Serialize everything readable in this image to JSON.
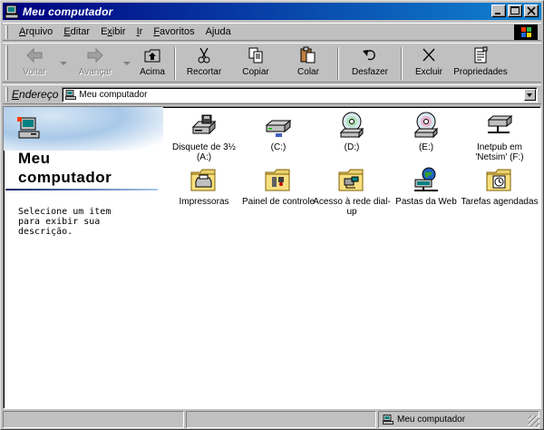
{
  "window": {
    "title": "Meu computador"
  },
  "menu": [
    {
      "label": "Arquivo",
      "accel": "A",
      "rest": "rquivo"
    },
    {
      "label": "Editar",
      "accel": "E",
      "rest": "ditar"
    },
    {
      "label": "Exibir",
      "accel": "x",
      "pre": "E",
      "rest": "ibir"
    },
    {
      "label": "Ir",
      "accel": "I",
      "rest": "r"
    },
    {
      "label": "Favoritos",
      "accel": "F",
      "rest": "avoritos"
    },
    {
      "label": "Ajuda",
      "accel": "j",
      "pre": "A",
      "rest": "uda"
    }
  ],
  "toolbar": {
    "back": "Voltar",
    "forward": "Avançar",
    "up": "Acima",
    "cut": "Recortar",
    "copy": "Copiar",
    "paste": "Colar",
    "undo": "Desfazer",
    "delete": "Excluir",
    "properties": "Propriedades"
  },
  "address": {
    "label_accel": "E",
    "label_rest": "ndereço",
    "value": "Meu computador"
  },
  "left_pane": {
    "title_line1": "Meu",
    "title_line2": "computador",
    "description": "Selecione um item para exibir sua descrição."
  },
  "items": [
    {
      "label": "Disquete de 3½ (A:)",
      "icon": "floppy-drive-icon"
    },
    {
      "label": "(C:)",
      "icon": "hard-drive-icon"
    },
    {
      "label": "(D:)",
      "icon": "cd-drive-icon"
    },
    {
      "label": "(E:)",
      "icon": "cd-drive-icon"
    },
    {
      "label": "Inetpub em 'Netsim' (F:)",
      "icon": "network-drive-icon"
    },
    {
      "label": "Impressoras",
      "icon": "printers-folder-icon"
    },
    {
      "label": "Painel de controle",
      "icon": "control-panel-folder-icon"
    },
    {
      "label": "Acesso à rede dial-up",
      "icon": "dialup-folder-icon"
    },
    {
      "label": "Pastas da Web",
      "icon": "web-folders-icon"
    },
    {
      "label": "Tarefas agendadas",
      "icon": "scheduled-tasks-folder-icon"
    }
  ],
  "status": {
    "location": "Meu computador"
  },
  "colors": {
    "title_start": "#000080",
    "title_end": "#1084d0",
    "face": "#c0c0c0"
  }
}
